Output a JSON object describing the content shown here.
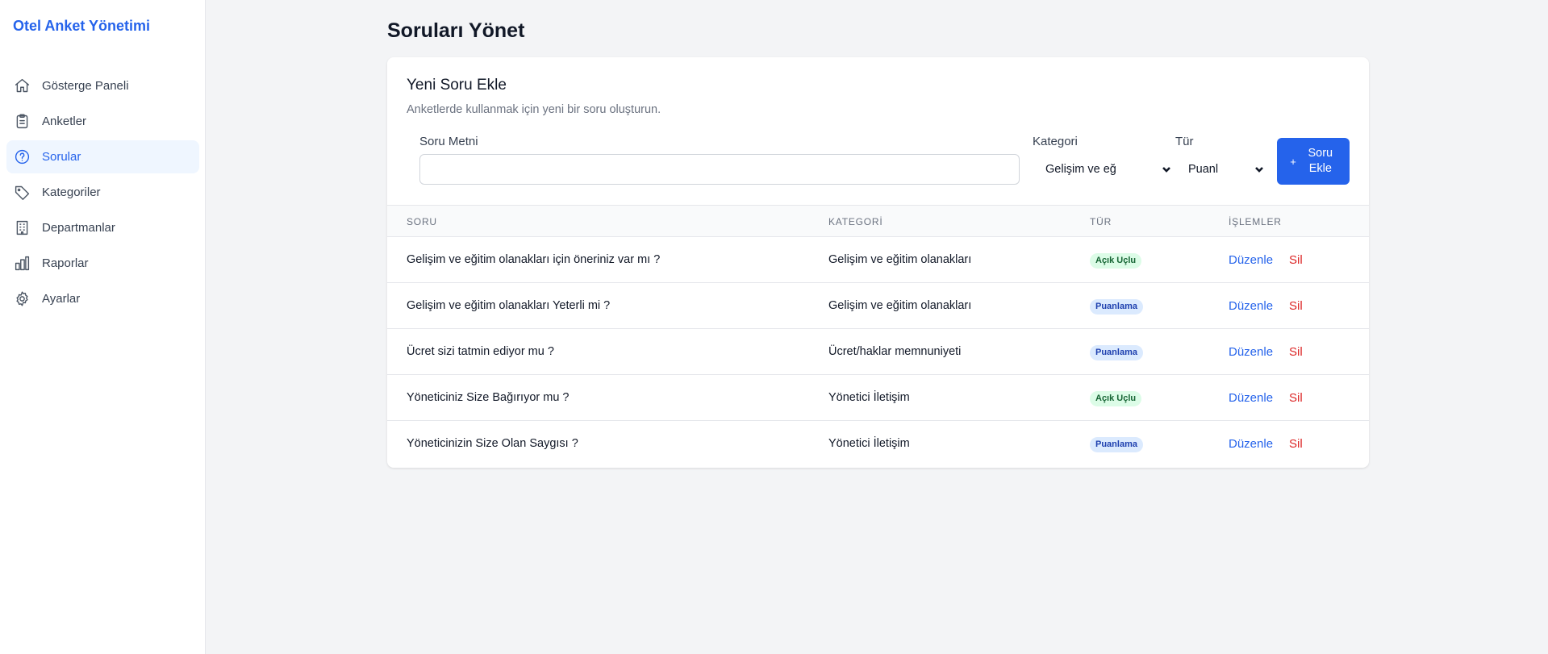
{
  "app": {
    "title": "Otel Anket Yönetimi"
  },
  "sidebar": {
    "items": [
      {
        "label": "Gösterge Paneli",
        "icon": "home-icon"
      },
      {
        "label": "Anketler",
        "icon": "clipboard-icon"
      },
      {
        "label": "Sorular",
        "icon": "question-circle-icon",
        "active": true
      },
      {
        "label": "Kategoriler",
        "icon": "tag-icon"
      },
      {
        "label": "Departmanlar",
        "icon": "building-icon"
      },
      {
        "label": "Raporlar",
        "icon": "bar-chart-icon"
      },
      {
        "label": "Ayarlar",
        "icon": "gear-icon"
      }
    ]
  },
  "page": {
    "title": "Soruları Yönet"
  },
  "form": {
    "title": "Yeni Soru Ekle",
    "subtitle": "Anketlerde kullanmak için yeni bir soru oluşturun.",
    "question_label": "Soru Metni",
    "question_value": "",
    "category_label": "Kategori",
    "category_value": "Gelişim ve eğ",
    "type_label": "Tür",
    "type_value": "Puanl",
    "add_button_icon": "+",
    "add_button_label": "Soru Ekle"
  },
  "table": {
    "headers": {
      "question": "SORU",
      "category": "KATEGORİ",
      "type": "TÜR",
      "actions": "İŞLEMLER"
    },
    "rows": [
      {
        "question": "Gelişim ve eğitim olanakları için öneriniz var mı ?",
        "category": "Gelişim ve eğitim olanakları",
        "type": "Açık Uçlu",
        "edit": "Düzenle",
        "delete": "Sil"
      },
      {
        "question": "Gelişim ve eğitim olanakları Yeterli mi ?",
        "category": "Gelişim ve eğitim olanakları",
        "type": "Puanlama",
        "edit": "Düzenle",
        "delete": "Sil"
      },
      {
        "question": "Ücret sizi tatmin ediyor mu ?",
        "category": "Ücret/haklar memnuniyeti",
        "type": "Puanlama",
        "edit": "Düzenle",
        "delete": "Sil"
      },
      {
        "question": "Yöneticiniz Size Bağırıyor mu ?",
        "category": "Yönetici İletişim",
        "type": "Açık Uçlu",
        "edit": "Düzenle",
        "delete": "Sil"
      },
      {
        "question": "Yöneticinizin Size Olan Saygısı ?",
        "category": "Yönetici İletişim",
        "type": "Puanlama",
        "edit": "Düzenle",
        "delete": "Sil"
      }
    ]
  },
  "colors": {
    "accent": "#2563eb",
    "danger": "#dc2626",
    "open_badge_bg": "#dcfce7",
    "rating_badge_bg": "#dbeafe"
  }
}
